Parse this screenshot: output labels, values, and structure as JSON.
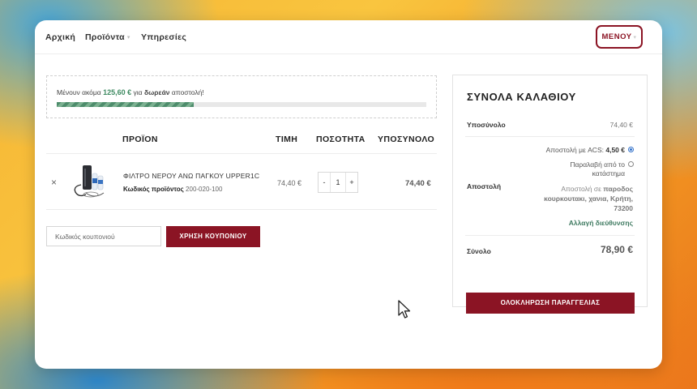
{
  "nav": {
    "home": "Αρχική",
    "products": "Προϊόντα",
    "services": "Υπηρεσίες",
    "menu_button": "ΜΕΝΟΥ"
  },
  "free_shipping": {
    "prefix": "Μένουν ακόμα",
    "amount": "125,60 €",
    "middle": "για",
    "bold": "δωρεάν",
    "suffix": "αποστολή!",
    "progress": 0.37
  },
  "cart_table": {
    "headers": {
      "product": "ΠΡΟΪΟΝ",
      "price": "ΤΙΜΗ",
      "quantity": "ΠΟΣΟΤΗΤΑ",
      "subtotal": "ΥΠΟΣΥΝΟΛΟ"
    },
    "items": [
      {
        "remove": "×",
        "name": "ΦΙΛΤΡΟ ΝΕΡΟΥ ΑΝΩ ΠΑΓΚΟΥ UPPER1C",
        "code_label": "Κωδικός προϊόντος",
        "code": "200-020-100",
        "price": "74,40 €",
        "qty_minus": "-",
        "qty": "1",
        "qty_plus": "+",
        "subtotal": "74,40 €"
      }
    ]
  },
  "coupon": {
    "placeholder": "Κωδικός κουπονιού",
    "button": "ΧΡΗΣΗ ΚΟΥΠΟΝΙΟΥ"
  },
  "totals": {
    "title": "ΣΥΝΟΛΑ ΚΑΛΑΘΙΟΥ",
    "subtotal_label": "Υποσύνολο",
    "subtotal_value": "74,40 €",
    "shipping_label": "Αποστολή",
    "shipping_option_1": "Αποστολή με ACS:",
    "shipping_option_1_price": "4,50 €",
    "shipping_option_2_line1": "Παραλαβή από το",
    "shipping_option_2_line2": "κατάστημα",
    "address_prefix": "Αποστολή σε",
    "address_line1": "παροδος",
    "address_line2": "κουρκουτακι, χανια, Κρήτη,",
    "address_line3": "73200",
    "change_address": "Αλλαγή διεύθυνσης",
    "total_label": "Σύνολο",
    "total_value": "78,90 €",
    "checkout_button": "ΟΛΟΚΛΗΡΩΣΗ ΠΑΡΑΓΓΕΛΙΑΣ"
  },
  "colors": {
    "brand": "#8b1424",
    "accent_green": "#3e8a61",
    "radio_blue": "#2f6fc9"
  }
}
